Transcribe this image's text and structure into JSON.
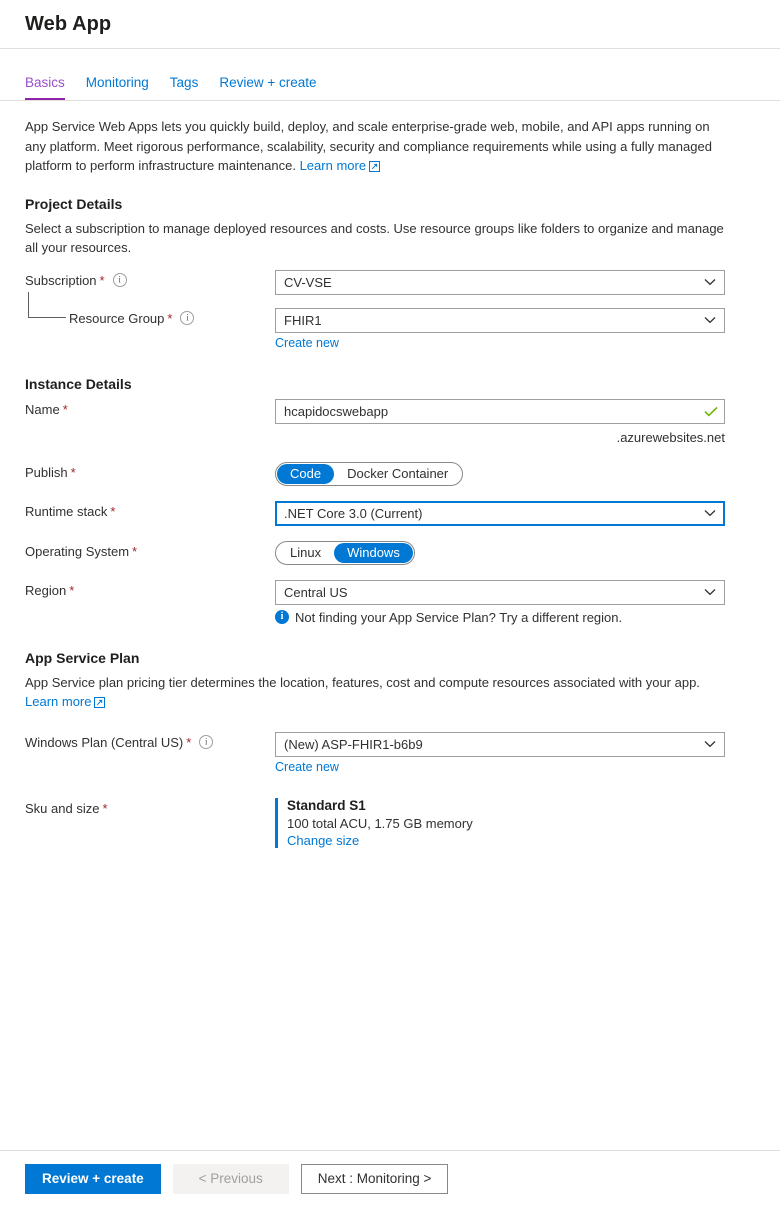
{
  "header": {
    "title": "Web App"
  },
  "tabs": [
    {
      "label": "Basics",
      "active": true
    },
    {
      "label": "Monitoring",
      "active": false
    },
    {
      "label": "Tags",
      "active": false
    },
    {
      "label": "Review + create",
      "active": false
    }
  ],
  "intro": {
    "text": "App Service Web Apps lets you quickly build, deploy, and scale enterprise-grade web, mobile, and API apps running on any platform. Meet rigorous performance, scalability, security and compliance requirements while using a fully managed platform to perform infrastructure maintenance.",
    "learn_more": "Learn more",
    "learn_more_icon": "external-link-icon"
  },
  "project_details": {
    "heading": "Project Details",
    "description": "Select a subscription to manage deployed resources and costs. Use resource groups like folders to organize and manage all your resources.",
    "subscription": {
      "label": "Subscription",
      "required": "*",
      "info_icon": "info-circle-icon",
      "value": "CV-VSE",
      "chevron": "chevron-down-icon"
    },
    "resource_group": {
      "label": "Resource Group",
      "required": "*",
      "info_icon": "info-circle-icon",
      "value": "FHIR1",
      "chevron": "chevron-down-icon",
      "create_new": "Create new"
    }
  },
  "instance_details": {
    "heading": "Instance Details",
    "name": {
      "label": "Name",
      "required": "*",
      "value": "hcapidocswebapp",
      "placeholder": "",
      "valid_icon": "checkmark-icon",
      "suffix": ".azurewebsites.net"
    },
    "publish": {
      "label": "Publish",
      "required": "*",
      "options": [
        "Code",
        "Docker Container"
      ],
      "selected": "Code"
    },
    "runtime_stack": {
      "label": "Runtime stack",
      "required": "*",
      "value": ".NET Core 3.0 (Current)",
      "chevron": "chevron-down-icon",
      "focused": true
    },
    "operating_system": {
      "label": "Operating System",
      "required": "*",
      "options": [
        "Linux",
        "Windows"
      ],
      "selected": "Windows"
    },
    "region": {
      "label": "Region",
      "required": "*",
      "value": "Central US",
      "chevron": "chevron-down-icon",
      "hint_icon": "info-filled-icon",
      "hint": "Not finding your App Service Plan? Try a different region."
    }
  },
  "app_service_plan": {
    "heading": "App Service Plan",
    "description": "App Service plan pricing tier determines the location, features, cost and compute resources associated with your app.",
    "learn_more": "Learn more",
    "learn_more_icon": "external-link-icon",
    "plan": {
      "label": "Windows Plan (Central US)",
      "required": "*",
      "info_icon": "info-circle-icon",
      "value": "(New) ASP-FHIR1-b6b9",
      "chevron": "chevron-down-icon",
      "create_new": "Create new"
    },
    "sku": {
      "label": "Sku and size",
      "required": "*",
      "title": "Standard S1",
      "description": "100 total ACU, 1.75 GB memory",
      "change_link": "Change size"
    }
  },
  "footer": {
    "review_create": "Review + create",
    "previous": "< Previous",
    "next": "Next : Monitoring >"
  },
  "colors": {
    "accent": "#0078d4",
    "active_tab": "#8e24aa",
    "required": "#a4262c",
    "success": "#6bb700"
  }
}
